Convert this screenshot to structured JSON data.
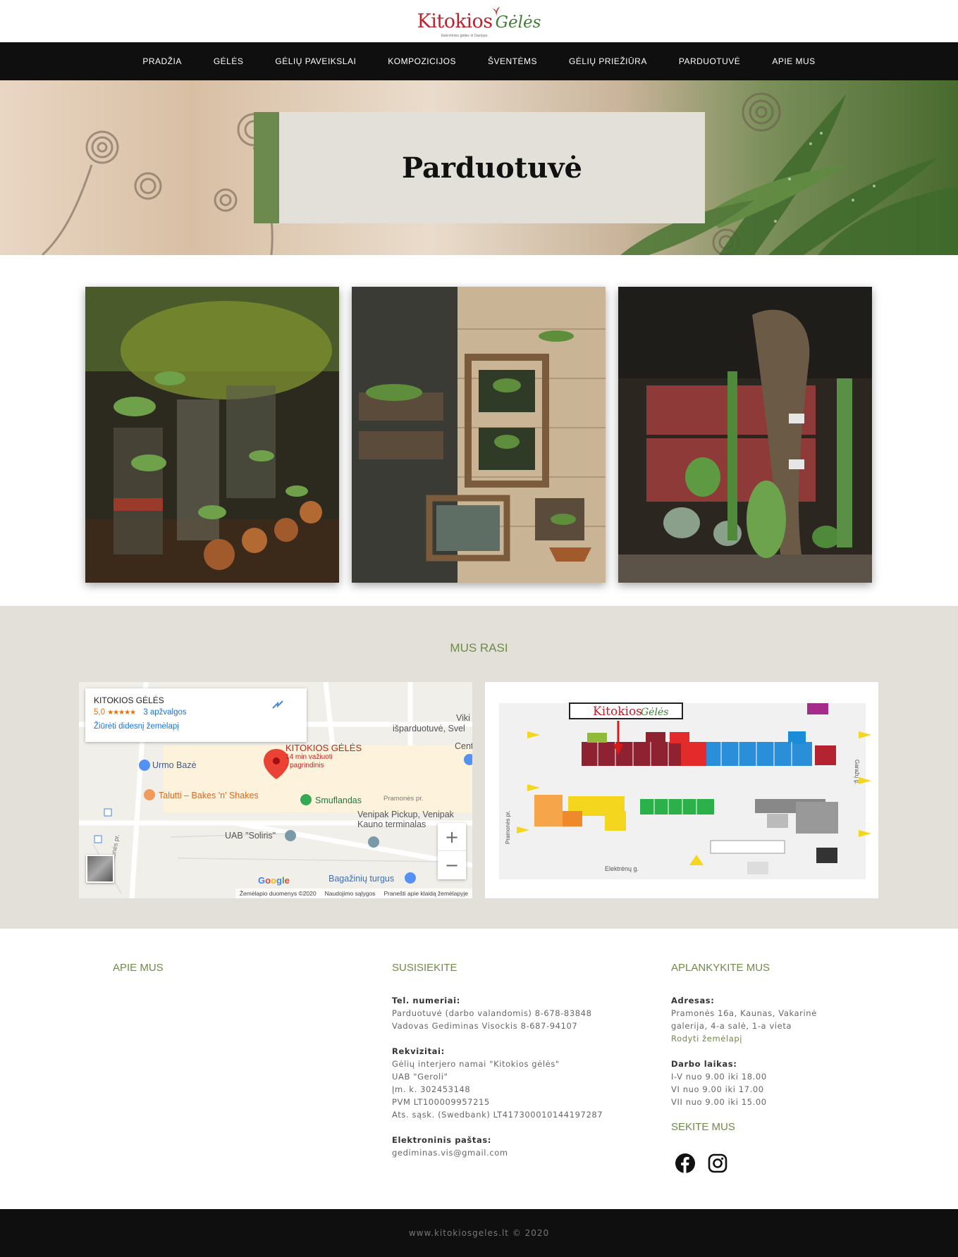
{
  "header": {
    "logo_main": "Kitokios",
    "logo_second": "Gėlės",
    "logo_tagline": "Išskirtinės gėlės iš Danijos"
  },
  "nav": {
    "items": [
      {
        "label": "PRADŽIA"
      },
      {
        "label": "GĖLĖS"
      },
      {
        "label": "GĖLIŲ PAVEIKSLAI"
      },
      {
        "label": "KOMPOZICIJOS"
      },
      {
        "label": "ŠVENTĖMS"
      },
      {
        "label": "GĖLIŲ PRIEŽIŪRA"
      },
      {
        "label": "PARDUOTUVĖ"
      },
      {
        "label": "APIE MUS"
      }
    ]
  },
  "hero": {
    "title": "Parduotuvė"
  },
  "find": {
    "title": "MUS RASI",
    "map": {
      "place_name": "KITOKIOS GĖLĖS",
      "rating": "5,0",
      "stars": "★★★★★",
      "reviews": "3 apžvalgos",
      "larger_map": "Žiūrėti didesnį žemėlapį",
      "pin_title": "KITOKIOS GĖLĖS",
      "pin_sub1": "14 min važiuoti",
      "pin_sub2": "- pagrindinis",
      "label_urmo": "Urmo Bazė",
      "label_talutti": "Talutti – Bakes 'n' Shakes",
      "label_smuflandas": "Smuflandas",
      "label_venipak1": "Venipak Pickup, Venipak",
      "label_venipak2": "Kauno terminalas",
      "label_soliris": "UAB \"Soliris\"",
      "label_bagaziniu": "Bagažinių turgus",
      "label_viki": "Viki",
      "label_ispard": "išparduotuvė, Svel",
      "label_cent": "Cent",
      "label_pramones": "Pramonės pr.",
      "label_pramones2": "Pramonės pr.",
      "google": "Google",
      "footer_data": "Žemėlapio duomenys ©2020",
      "footer_terms": "Naudojimo sąlygos",
      "footer_report": "Pranešti apie klaidą žemėlapyje",
      "zoom_in": "+",
      "zoom_out": "−"
    },
    "plan": {
      "logo_main": "Kitokios",
      "logo_second": "Gėlės",
      "street_bottom": "Elektrėnų g.",
      "street_left": "Pramonės pr.",
      "street_right": "Garažų g."
    }
  },
  "about": {
    "title": "APIE MUS"
  },
  "contact": {
    "title": "SUSISIEKITE",
    "phones_label": "Tel. numeriai:",
    "phone1": "Parduotuvė (darbo valandomis) 8-678-83848",
    "phone2": "Vadovas Gediminas Visockis 8-687-94107",
    "req_label": "Rekvizitai:",
    "req1": "Gėlių interjero namai \"Kitokios gėlės\"",
    "req2": "UAB \"Geroli\"",
    "req3": "Įm. k. 302453148",
    "req4": "PVM LT100009957215",
    "req5": "Ats. sąsk. (Swedbank) LT417300010144197287",
    "email_label": "Elektroninis paštas:",
    "email": "gediminas.vis@gmail.com"
  },
  "visit": {
    "title": "APLANKYKITE MUS",
    "addr_label": "Adresas:",
    "addr1": "Pramonės 16a, Kaunas, Vakarinė",
    "addr2": "galerija, 4-a salė, 1-a vieta",
    "map_link": "Rodyti žemėlapį",
    "hours_label": "Darbo laikas:",
    "hours1": "I-V nuo 9.00 iki 18.00",
    "hours2": "VI nuo 9.00 iki 17.00",
    "hours3": "VII nuo 9.00 iki 15.00",
    "follow_title": "SEKITE MUS",
    "icons": [
      "facebook-icon",
      "instagram-icon"
    ]
  },
  "footer": {
    "copyright": "www.kitokiosgeles.lt © 2020"
  },
  "colors": {
    "accent": "#6f8b4a",
    "nav_bg": "#0f0f0f",
    "logo_red": "#c0202a",
    "section_bg": "#e2e0d8"
  }
}
